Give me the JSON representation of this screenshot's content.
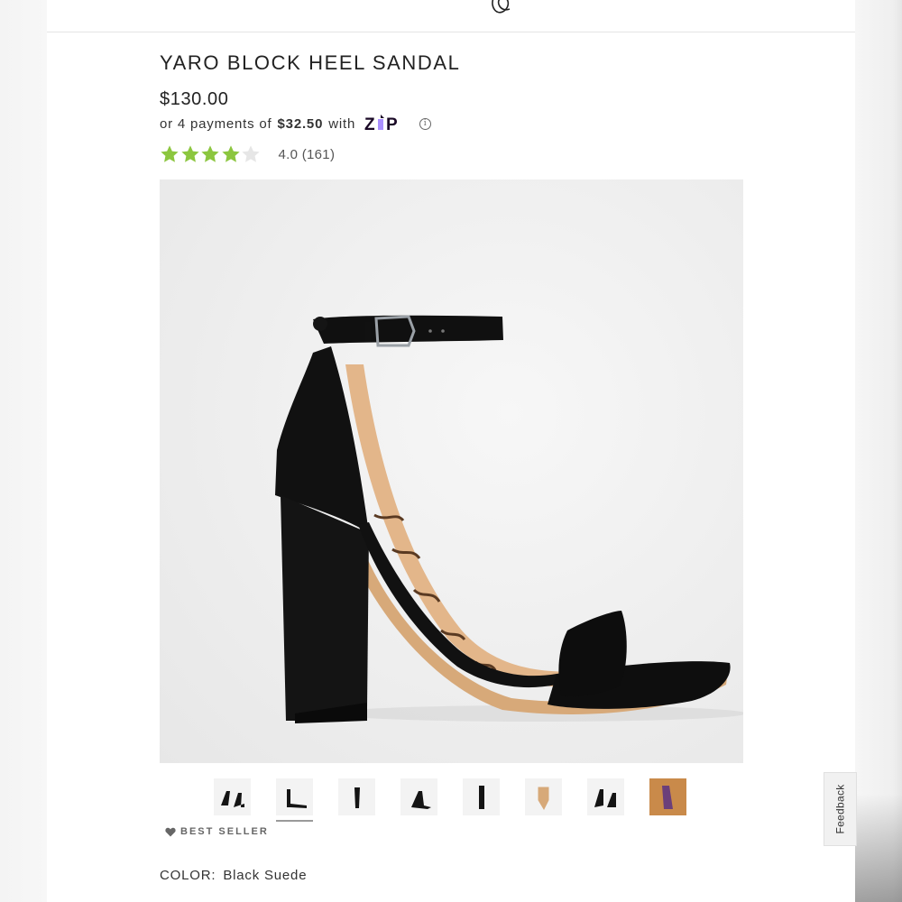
{
  "product": {
    "title": "YARO BLOCK HEEL SANDAL",
    "price": "$130.00",
    "installments": {
      "prefix": "or 4 payments of",
      "amount": "$32.50",
      "suffix": "with",
      "provider": "ZIP",
      "info_icon": "info-icon"
    },
    "rating": {
      "value": 4.0,
      "max": 5,
      "text": "4.0 (161)",
      "star_color": "#8cc63f",
      "empty_star_color": "#e6e6e6"
    },
    "hero_image": {
      "icon": "black-block-heel-sandal-photo"
    },
    "thumbnails": [
      {
        "name": "thumb-pair-angle",
        "selected": false
      },
      {
        "name": "thumb-side-view",
        "selected": true
      },
      {
        "name": "thumb-front-view",
        "selected": false
      },
      {
        "name": "thumb-inner-side",
        "selected": false
      },
      {
        "name": "thumb-back-view",
        "selected": false
      },
      {
        "name": "thumb-sole-view",
        "selected": false
      },
      {
        "name": "thumb-pair-alt",
        "selected": false
      },
      {
        "name": "thumb-on-model",
        "selected": false
      }
    ],
    "badge": "BEST SELLER",
    "color": {
      "label": "COLOR:",
      "value": "Black Suede"
    }
  },
  "feedback_tab": "Feedback",
  "colors": {
    "accent_star": "#8cc63f",
    "zip_purple": "#aa8fff",
    "zip_dark": "#1a0826"
  }
}
